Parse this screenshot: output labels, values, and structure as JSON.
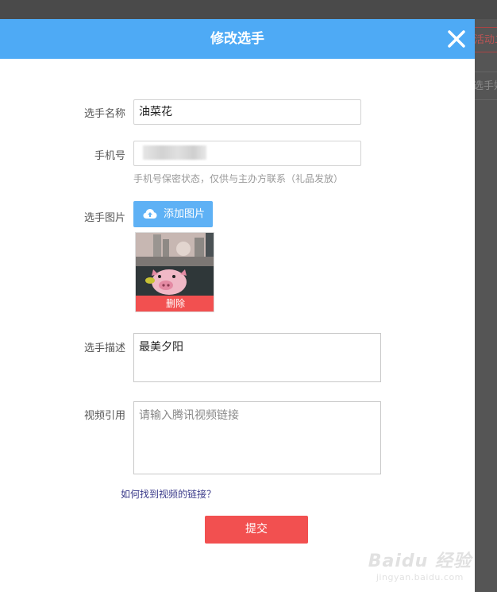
{
  "background": {
    "tag1": "活动二",
    "tag2": "选手姓名"
  },
  "modal": {
    "title": "修改选手",
    "close_icon": "close-icon"
  },
  "form": {
    "name_label": "选手名称",
    "name_value": "油菜花",
    "phone_label": "手机号",
    "phone_hint": "手机号保密状态，仅供与主办方联系（礼品发放）",
    "photo_label": "选手图片",
    "upload_button": "添加图片",
    "upload_icon": "cloud-upload-icon",
    "delete_label": "删除",
    "desc_label": "选手描述",
    "desc_value": "最美夕阳",
    "video_label": "视频引用",
    "video_placeholder": "请输入腾讯视频链接",
    "help_link": "如何找到视频的链接？",
    "submit_button": "提交"
  },
  "watermark": {
    "brand": "Baidu 经验",
    "url": "jingyan.baidu.com"
  },
  "colors": {
    "header": "#4eaaf5",
    "upload": "#5eb1f5",
    "danger": "#f25050"
  }
}
